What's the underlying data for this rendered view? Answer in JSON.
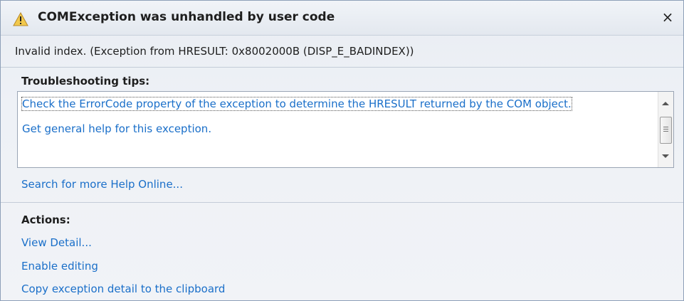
{
  "dialog": {
    "title": "COMException was unhandled by user code",
    "close_label": "×",
    "message": "Invalid index. (Exception from HRESULT: 0x8002000B (DISP_E_BADINDEX))",
    "icons": {
      "title": "warning-icon",
      "close": "close-icon"
    }
  },
  "troubleshooting": {
    "heading": "Troubleshooting tips:",
    "tips": [
      "Check the ErrorCode property of the exception to determine the HRESULT returned by the COM object.",
      "Get general help for this exception."
    ],
    "search_link": "Search for more Help Online..."
  },
  "actions": {
    "heading": "Actions:",
    "links": [
      "View Detail...",
      "Enable editing",
      "Copy exception detail to the clipboard"
    ]
  },
  "colors": {
    "link": "#1a6fc9",
    "warning": "#f2c94c"
  }
}
